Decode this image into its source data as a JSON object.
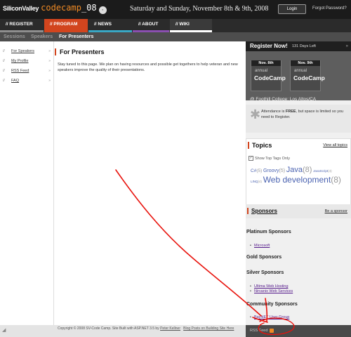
{
  "header": {
    "logo_left": "SiliconValley",
    "logo_mid": "codecamp",
    "logo_year": "_08",
    "event_dates": "Saturday and Sunday, November 8th & 9th, 2008",
    "login_label": "Login",
    "forgot_password": "Forgot Password?"
  },
  "nav": {
    "tabs": [
      {
        "label": "// REGISTER",
        "bar_color": "#8e8e8e"
      },
      {
        "label": "// PROGRAM",
        "bar_color": "#d2451e"
      },
      {
        "label": "// NEWS",
        "bar_color": "#39a7c4"
      },
      {
        "label": "// ABOUT",
        "bar_color": "#8a4fb0"
      },
      {
        "label": "// WIKI",
        "bar_color": "#ffffff"
      }
    ]
  },
  "subnav": {
    "items": [
      "Sessions",
      "Speakers",
      "For Presenters"
    ]
  },
  "sidebar": {
    "items": [
      {
        "label": "For Speakers",
        "icon": "slash-icon"
      },
      {
        "label": "My Profile",
        "icon": "slash-icon"
      },
      {
        "label": "RSS Feed",
        "icon": "slash-icon"
      },
      {
        "label": "FAQ",
        "icon": "slash-icon"
      }
    ],
    "arrow": "»"
  },
  "main": {
    "title": "For Presenters",
    "intro": "Stay tuned to this page.  We plan on having resources and possible get togethers to help veteran and new speakers improve the quality of their presentations."
  },
  "register": {
    "title": "Register Now!",
    "days_left": "131 Days Left",
    "arrow": "»",
    "badges": [
      {
        "date": "Nov. 8th",
        "annual": "annual",
        "name": "CodeCamp"
      },
      {
        "date": "Nov. 9th",
        "annual": "annual",
        "name": "CodeCamp"
      }
    ],
    "venue": "@ Foothill College: Los Altos/CA"
  },
  "attendance": {
    "pre": "Attendance is ",
    "free": "FREE",
    "post": ", but space is limited so you need to Register."
  },
  "topics": {
    "title": "Topics",
    "view_all": "View all topics",
    "show_top_tags": "Show Top Tags Only",
    "tags": [
      {
        "name": "C#",
        "count": "(5)"
      },
      {
        "name": "Groovy",
        "count": "(5)"
      },
      {
        "name": "Java",
        "count": "(8)"
      },
      {
        "name": "JavaScript",
        "count": "(4)"
      },
      {
        "name": "LINQ",
        "count": "(4)"
      },
      {
        "name": "Web development",
        "count": "(8)"
      }
    ]
  },
  "sponsors": {
    "title": "Sponsors",
    "be_a_sponsor": "Be a sponsor",
    "sections": [
      {
        "title": "Platinum Sponsors",
        "links": [
          "Microsoft"
        ]
      },
      {
        "title": "Gold Sponsors",
        "links": []
      },
      {
        "title": "Silver Sponsors",
        "links": [
          "Ultima Web Hosting",
          "Nirvanix Web Services"
        ]
      },
      {
        "title": "Community Sponsors",
        "links": [
          "BayNET User Group"
        ]
      }
    ]
  },
  "rss": {
    "label": "RSS Feed"
  },
  "footer": {
    "copyright": "Copyright © 2008 SV-Code Camp.  Site Built with ASP.NET 3.5 by ",
    "author": "Peter Kellner",
    "blog": "Blog Posts on Building Site Here"
  },
  "annotation": {
    "color": "#e8120c"
  }
}
